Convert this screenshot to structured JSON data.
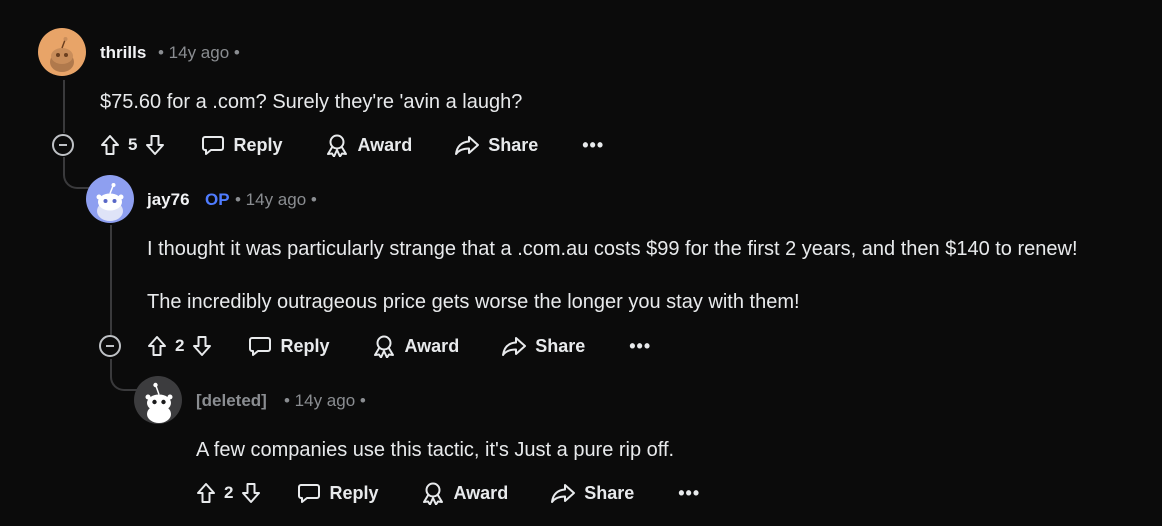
{
  "comments": [
    {
      "username": "thrills",
      "is_op": false,
      "time_meta": "• 14y ago •",
      "body": [
        "$75.60 for a .com? Surely they're 'avin a laugh?"
      ],
      "score": "5",
      "actions": {
        "reply": "Reply",
        "award": "Award",
        "share": "Share",
        "more": "•••"
      }
    },
    {
      "username": "jay76",
      "is_op": true,
      "op_label": "OP",
      "time_meta": "• 14y ago •",
      "body": [
        "I thought it was particularly strange that a .com.au costs $99 for the first 2 years, and then $140 to renew!",
        "The incredibly outrageous price gets worse the longer you stay with them!"
      ],
      "score": "2",
      "actions": {
        "reply": "Reply",
        "award": "Award",
        "share": "Share",
        "more": "•••"
      }
    },
    {
      "username": "[deleted]",
      "is_op": false,
      "time_meta": "• 14y ago •",
      "body": [
        "A few companies use this tactic, it's Just a pure rip off."
      ],
      "score": "2",
      "actions": {
        "reply": "Reply",
        "award": "Award",
        "share": "Share",
        "more": "•••"
      }
    }
  ],
  "colors": {
    "background": "#0b0b0b",
    "op_accent": "#4f7cff",
    "avatar_thrills": "#e8a468",
    "avatar_jay76": "#8e9ff0",
    "avatar_deleted": "#3c3c3e"
  }
}
